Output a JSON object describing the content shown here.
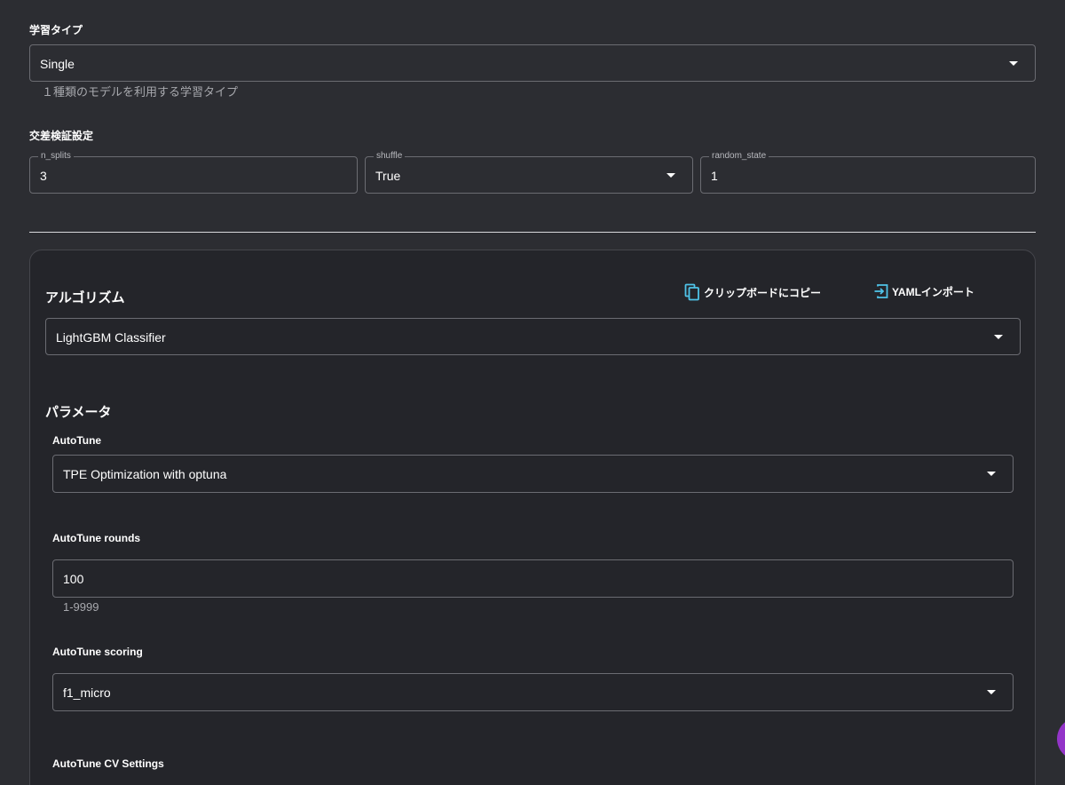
{
  "training_type": {
    "label": "学習タイプ",
    "value": "Single",
    "helper": "１種類のモデルを利用する学習タイプ"
  },
  "cross_validation": {
    "label": "交差検証設定",
    "n_splits": {
      "label": "n_splits",
      "value": "3"
    },
    "shuffle": {
      "label": "shuffle",
      "value": "True"
    },
    "random_state": {
      "label": "random_state",
      "value": "1"
    }
  },
  "algorithm": {
    "title": "アルゴリズム",
    "copy_label": "クリップボードにコピー",
    "import_label": "YAMLインポート",
    "value": "LightGBM Classifier"
  },
  "parameters": {
    "title": "パラメータ",
    "autotune": {
      "label": "AutoTune",
      "value": "TPE Optimization with optuna"
    },
    "autotune_rounds": {
      "label": "AutoTune rounds",
      "value": "100",
      "helper": "1-9999"
    },
    "autotune_scoring": {
      "label": "AutoTune scoring",
      "value": "f1_micro"
    },
    "autotune_cv": {
      "label": "AutoTune CV Settings"
    }
  },
  "icons": {
    "copy": "copy-icon",
    "import": "import-icon",
    "dropdown": "chevron-down-icon"
  },
  "colors": {
    "background": "#2c2d32",
    "card": "#24252a",
    "accent": "#4fc3e8",
    "fab": "#9334c8"
  }
}
